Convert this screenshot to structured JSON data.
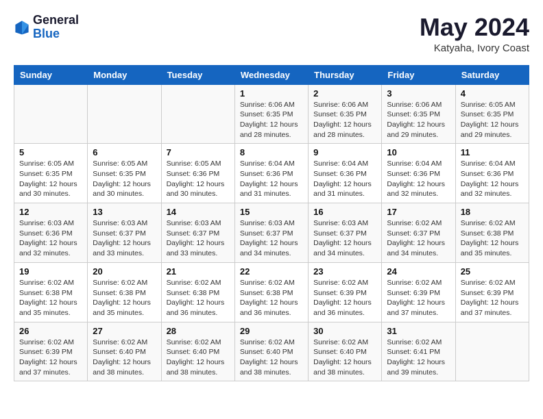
{
  "header": {
    "logo_general": "General",
    "logo_blue": "Blue",
    "month_year": "May 2024",
    "location": "Katyaha, Ivory Coast"
  },
  "days_of_week": [
    "Sunday",
    "Monday",
    "Tuesday",
    "Wednesday",
    "Thursday",
    "Friday",
    "Saturday"
  ],
  "weeks": [
    [
      {
        "day": "",
        "info": ""
      },
      {
        "day": "",
        "info": ""
      },
      {
        "day": "",
        "info": ""
      },
      {
        "day": "1",
        "info": "Sunrise: 6:06 AM\nSunset: 6:35 PM\nDaylight: 12 hours\nand 28 minutes."
      },
      {
        "day": "2",
        "info": "Sunrise: 6:06 AM\nSunset: 6:35 PM\nDaylight: 12 hours\nand 28 minutes."
      },
      {
        "day": "3",
        "info": "Sunrise: 6:06 AM\nSunset: 6:35 PM\nDaylight: 12 hours\nand 29 minutes."
      },
      {
        "day": "4",
        "info": "Sunrise: 6:05 AM\nSunset: 6:35 PM\nDaylight: 12 hours\nand 29 minutes."
      }
    ],
    [
      {
        "day": "5",
        "info": "Sunrise: 6:05 AM\nSunset: 6:35 PM\nDaylight: 12 hours\nand 30 minutes."
      },
      {
        "day": "6",
        "info": "Sunrise: 6:05 AM\nSunset: 6:35 PM\nDaylight: 12 hours\nand 30 minutes."
      },
      {
        "day": "7",
        "info": "Sunrise: 6:05 AM\nSunset: 6:36 PM\nDaylight: 12 hours\nand 30 minutes."
      },
      {
        "day": "8",
        "info": "Sunrise: 6:04 AM\nSunset: 6:36 PM\nDaylight: 12 hours\nand 31 minutes."
      },
      {
        "day": "9",
        "info": "Sunrise: 6:04 AM\nSunset: 6:36 PM\nDaylight: 12 hours\nand 31 minutes."
      },
      {
        "day": "10",
        "info": "Sunrise: 6:04 AM\nSunset: 6:36 PM\nDaylight: 12 hours\nand 32 minutes."
      },
      {
        "day": "11",
        "info": "Sunrise: 6:04 AM\nSunset: 6:36 PM\nDaylight: 12 hours\nand 32 minutes."
      }
    ],
    [
      {
        "day": "12",
        "info": "Sunrise: 6:03 AM\nSunset: 6:36 PM\nDaylight: 12 hours\nand 32 minutes."
      },
      {
        "day": "13",
        "info": "Sunrise: 6:03 AM\nSunset: 6:37 PM\nDaylight: 12 hours\nand 33 minutes."
      },
      {
        "day": "14",
        "info": "Sunrise: 6:03 AM\nSunset: 6:37 PM\nDaylight: 12 hours\nand 33 minutes."
      },
      {
        "day": "15",
        "info": "Sunrise: 6:03 AM\nSunset: 6:37 PM\nDaylight: 12 hours\nand 34 minutes."
      },
      {
        "day": "16",
        "info": "Sunrise: 6:03 AM\nSunset: 6:37 PM\nDaylight: 12 hours\nand 34 minutes."
      },
      {
        "day": "17",
        "info": "Sunrise: 6:02 AM\nSunset: 6:37 PM\nDaylight: 12 hours\nand 34 minutes."
      },
      {
        "day": "18",
        "info": "Sunrise: 6:02 AM\nSunset: 6:38 PM\nDaylight: 12 hours\nand 35 minutes."
      }
    ],
    [
      {
        "day": "19",
        "info": "Sunrise: 6:02 AM\nSunset: 6:38 PM\nDaylight: 12 hours\nand 35 minutes."
      },
      {
        "day": "20",
        "info": "Sunrise: 6:02 AM\nSunset: 6:38 PM\nDaylight: 12 hours\nand 35 minutes."
      },
      {
        "day": "21",
        "info": "Sunrise: 6:02 AM\nSunset: 6:38 PM\nDaylight: 12 hours\nand 36 minutes."
      },
      {
        "day": "22",
        "info": "Sunrise: 6:02 AM\nSunset: 6:38 PM\nDaylight: 12 hours\nand 36 minutes."
      },
      {
        "day": "23",
        "info": "Sunrise: 6:02 AM\nSunset: 6:39 PM\nDaylight: 12 hours\nand 36 minutes."
      },
      {
        "day": "24",
        "info": "Sunrise: 6:02 AM\nSunset: 6:39 PM\nDaylight: 12 hours\nand 37 minutes."
      },
      {
        "day": "25",
        "info": "Sunrise: 6:02 AM\nSunset: 6:39 PM\nDaylight: 12 hours\nand 37 minutes."
      }
    ],
    [
      {
        "day": "26",
        "info": "Sunrise: 6:02 AM\nSunset: 6:39 PM\nDaylight: 12 hours\nand 37 minutes."
      },
      {
        "day": "27",
        "info": "Sunrise: 6:02 AM\nSunset: 6:40 PM\nDaylight: 12 hours\nand 38 minutes."
      },
      {
        "day": "28",
        "info": "Sunrise: 6:02 AM\nSunset: 6:40 PM\nDaylight: 12 hours\nand 38 minutes."
      },
      {
        "day": "29",
        "info": "Sunrise: 6:02 AM\nSunset: 6:40 PM\nDaylight: 12 hours\nand 38 minutes."
      },
      {
        "day": "30",
        "info": "Sunrise: 6:02 AM\nSunset: 6:40 PM\nDaylight: 12 hours\nand 38 minutes."
      },
      {
        "day": "31",
        "info": "Sunrise: 6:02 AM\nSunset: 6:41 PM\nDaylight: 12 hours\nand 39 minutes."
      },
      {
        "day": "",
        "info": ""
      }
    ]
  ]
}
